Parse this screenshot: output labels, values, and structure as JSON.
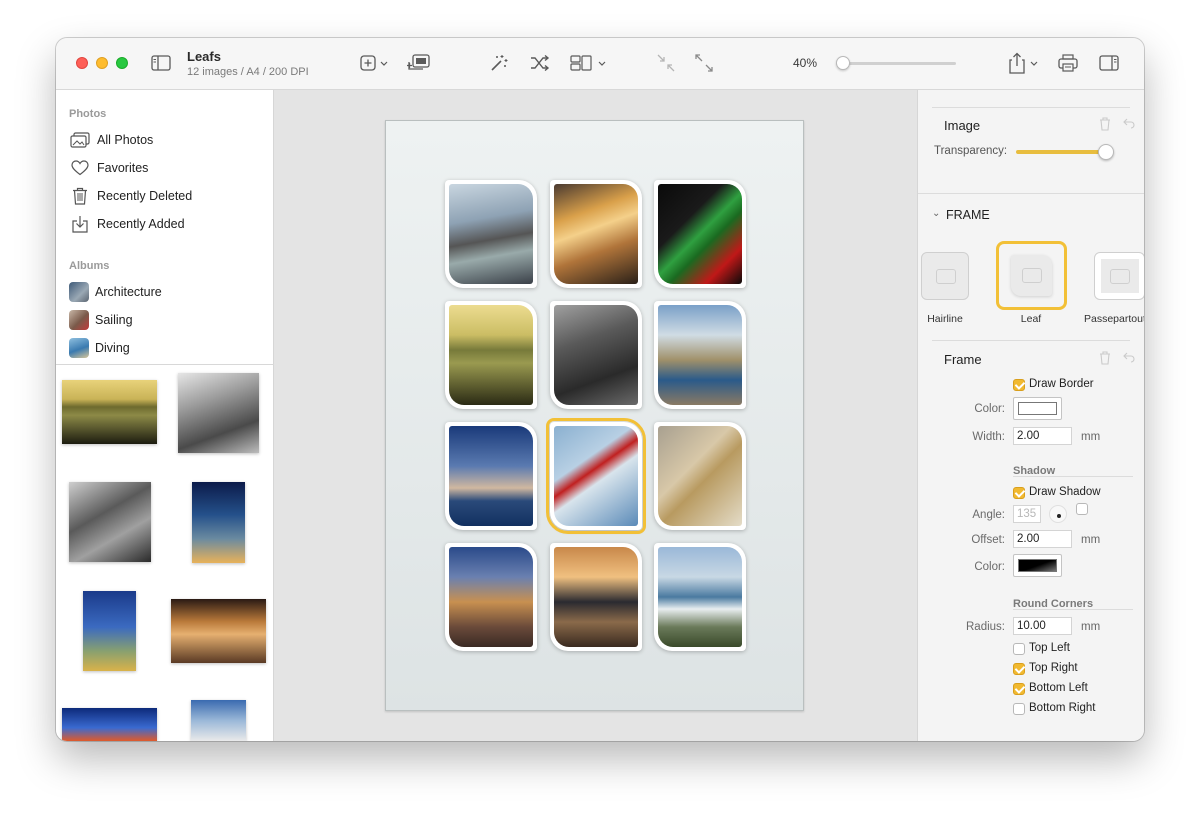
{
  "document": {
    "title": "Leafs",
    "subtitle": "12 images / A4 / 200 DPI"
  },
  "toolbar": {
    "zoom_label": "40%",
    "zoom_level": 0.05,
    "icons": [
      "sidebar-toggle-icon",
      "add-icon",
      "slideshow-icon",
      "magic-wand-icon",
      "shuffle-icon",
      "layout-icon",
      "shrink-icon",
      "expand-icon",
      "share-icon",
      "print-icon",
      "inspector-toggle-icon"
    ]
  },
  "sidebar": {
    "photos_header": "Photos",
    "photos": [
      {
        "label": "All Photos",
        "icon": "photos-icon"
      },
      {
        "label": "Favorites",
        "icon": "heart-icon"
      },
      {
        "label": "Recently Deleted",
        "icon": "trash-icon"
      },
      {
        "label": "Recently Added",
        "icon": "import-icon"
      }
    ],
    "albums_header": "Albums",
    "albums": [
      {
        "label": "Architecture"
      },
      {
        "label": "Sailing"
      },
      {
        "label": "Diving"
      }
    ]
  },
  "inspector": {
    "image_title": "Image",
    "transparency_label": "Transparency:",
    "transparency_value": 1.0,
    "frame_section": "FRAME",
    "frame_options": [
      "Hairline",
      "Leaf",
      "Passepartout"
    ],
    "frame_selected": "Leaf",
    "frame_title": "Frame",
    "draw_border": "Draw Border",
    "color_label": "Color:",
    "width_label": "Width:",
    "width_value": "2.00",
    "unit": "mm",
    "shadow_head": "Shadow",
    "draw_shadow": "Draw Shadow",
    "angle_label": "Angle:",
    "angle_value": "135",
    "offset_label": "Offset:",
    "offset_value": "2.00",
    "shadow_color_label": "Color:",
    "round_head": "Round Corners",
    "radius_label": "Radius:",
    "radius_value": "10.00",
    "corners": [
      {
        "label": "Top Left",
        "checked": false
      },
      {
        "label": "Top Right",
        "checked": true
      },
      {
        "label": "Bottom Left",
        "checked": true
      },
      {
        "label": "Bottom Right",
        "checked": false
      }
    ],
    "accent": "#f2c037"
  }
}
